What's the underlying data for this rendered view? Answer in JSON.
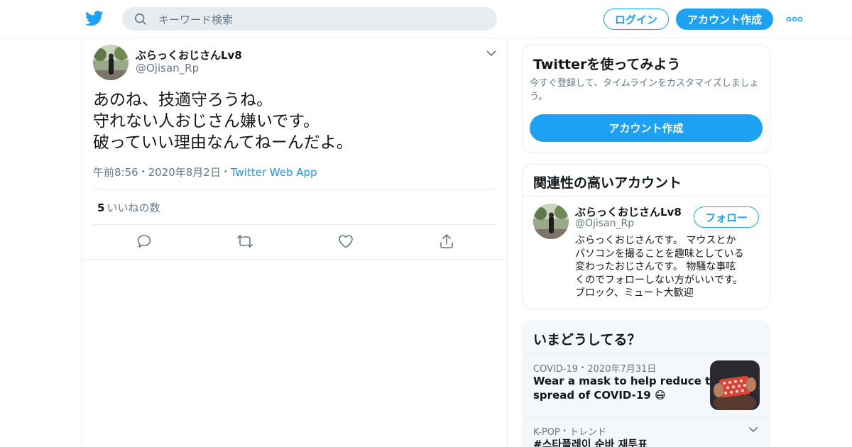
{
  "header": {
    "search_placeholder": "キーワード検索",
    "login_label": "ログイン",
    "signup_label": "アカウント作成"
  },
  "tweet": {
    "author_name": "ぶらっくおじさんLv8",
    "author_handle": "@Ojisan_Rp",
    "text_lines": [
      "あのね、技適守ろうね。",
      "守れない人おじさん嫌いです。",
      "破っていい理由なんてねーんだよ。"
    ],
    "time": "午前8:56",
    "date": "2020年8月2日",
    "source": "Twitter Web App",
    "likes_count": "5",
    "likes_label": "いいねの数"
  },
  "signup_card": {
    "title": "Twitterを使ってみよう",
    "subtitle": "今すぐ登録して、タイムラインをカスタマイズしましょう。",
    "button_label": "アカウント作成"
  },
  "related_card": {
    "title": "関連性の高いアカウント",
    "account_name": "ぶらっくおじさんLv8",
    "account_handle": "@Ojisan_Rp",
    "follow_label": "フォロー",
    "bio_lines": [
      "ぶらっくおじさんです。 マウスとか",
      "パソコンを撮ることを趣味としている",
      "変わったおじさんです。 物騒な事呟",
      "くのでフォローしない方がいいです。",
      "ブロック、ミュート大歓迎"
    ]
  },
  "trends_card": {
    "title": "いまどうしてる？",
    "items": [
      {
        "category": "COVID-19",
        "date": "2020年7月31日",
        "text_lines": [
          "Wear a mask to help reduce the",
          "spread of COVID-19 😷"
        ]
      },
      {
        "category": "K-POP",
        "type": "トレンド",
        "text_lines": [
          "#스타플레이 순바 재투표"
        ]
      }
    ]
  },
  "icons": [
    "twitter-bird-icon",
    "search-icon",
    "more-icon",
    "chevron-down-icon",
    "reply-icon",
    "retweet-icon",
    "like-icon",
    "share-icon"
  ],
  "colors": {
    "brand": "#1da1f2",
    "link": "#1b95e0",
    "muted": "#657786",
    "text": "#14171a",
    "divider": "#e6ecf0",
    "panel_bg": "#f5f8fa"
  }
}
